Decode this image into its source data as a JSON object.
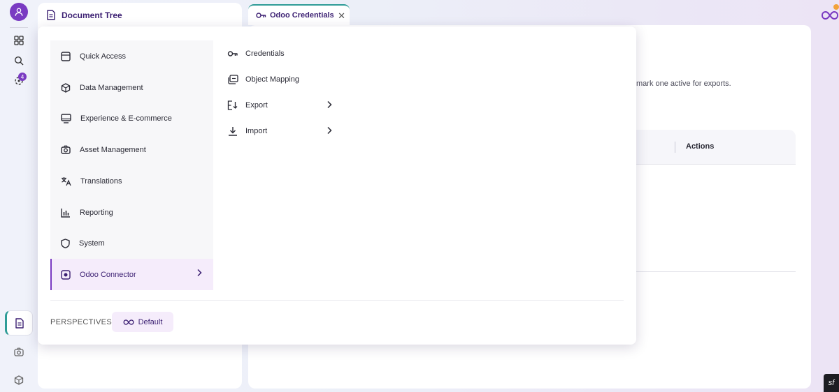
{
  "rail": {
    "notification_count": "4",
    "brand_color": "#7a3bc2",
    "accent_color": "#2f9c97",
    "icons": [
      "user-icon",
      "grid-icon",
      "search-icon",
      "notification-icon",
      "document-icon",
      "camera-icon",
      "cube-icon"
    ]
  },
  "left_panel": {
    "title": "Document Tree"
  },
  "tab": {
    "label": "Odoo Credentials",
    "close": "✕"
  },
  "main": {
    "description_fragment": "mark one active for exports.",
    "table": {
      "columns": [
        "Actions"
      ]
    }
  },
  "menu": {
    "categories": [
      {
        "label": "Quick Access",
        "icon": "window-icon"
      },
      {
        "label": "Data Management",
        "icon": "box-icon"
      },
      {
        "label": "Experience & E-commerce",
        "icon": "monitor-icon"
      },
      {
        "label": "Asset Management",
        "icon": "camera-icon"
      },
      {
        "label": "Translations",
        "icon": "translate-icon"
      },
      {
        "label": "Reporting",
        "icon": "bar-chart-icon"
      },
      {
        "label": "System",
        "icon": "shield-icon"
      },
      {
        "label": "Odoo Connector",
        "icon": "odoo-icon",
        "active": true
      }
    ],
    "sub_items": [
      {
        "label": "Credentials",
        "icon": "key-icon"
      },
      {
        "label": "Object Mapping",
        "icon": "layers-icon"
      },
      {
        "label": "Export",
        "icon": "export-icon",
        "has_submenu": true
      },
      {
        "label": "Import",
        "icon": "download-icon",
        "has_submenu": true
      }
    ],
    "perspectives_label": "PERSPECTIVES",
    "perspective_default": "Default"
  }
}
